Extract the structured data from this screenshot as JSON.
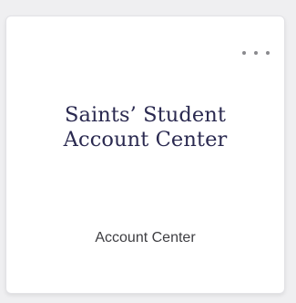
{
  "card": {
    "title_line1": "Saints’ Student",
    "title_line2": "Account Center",
    "subtitle": "Account Center",
    "menu_icon": "more-horizontal-icon"
  },
  "colors": {
    "background": "#efeff1",
    "card": "#ffffff",
    "title": "#2a2950",
    "subtitle": "#3e3e42",
    "menu_dots": "#8a8a8e"
  }
}
